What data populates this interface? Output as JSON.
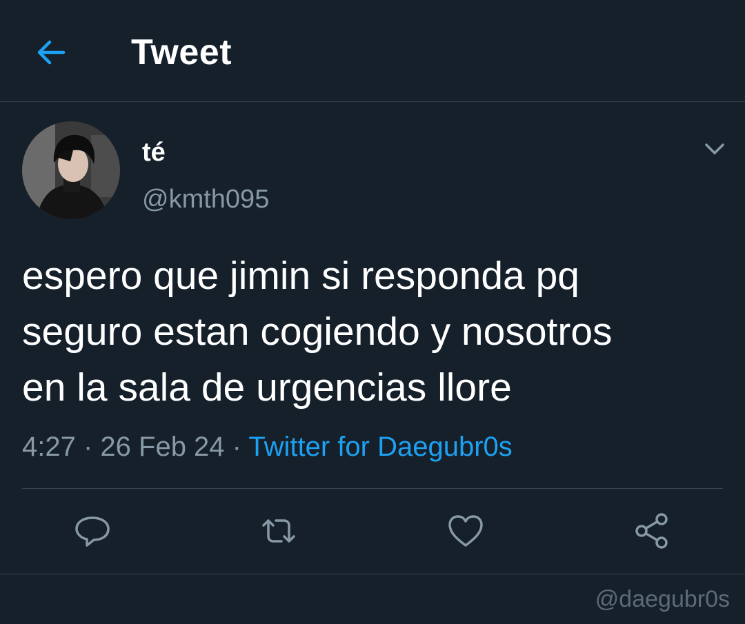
{
  "header": {
    "title": "Tweet"
  },
  "user": {
    "display_name": "té",
    "handle": "@kmth095"
  },
  "tweet": {
    "text": "espero que jimin si responda pq\nseguro estan cogiendo y nosotros\nen la sala de urgencias llore",
    "time": "4:27",
    "separator": " · ",
    "date": "26 Feb 24",
    "source": "Twitter for Daegubr0s"
  },
  "icons": {
    "back": "arrow-left-icon",
    "caret": "chevron-down-icon",
    "reply": "reply-icon",
    "retweet": "retweet-icon",
    "like": "heart-icon",
    "share": "share-icon"
  },
  "colors": {
    "background": "#15202b",
    "accent": "#1da1f2",
    "secondary_text": "#8899a6",
    "divider": "#38444d"
  },
  "watermark": "@daegubr0s"
}
